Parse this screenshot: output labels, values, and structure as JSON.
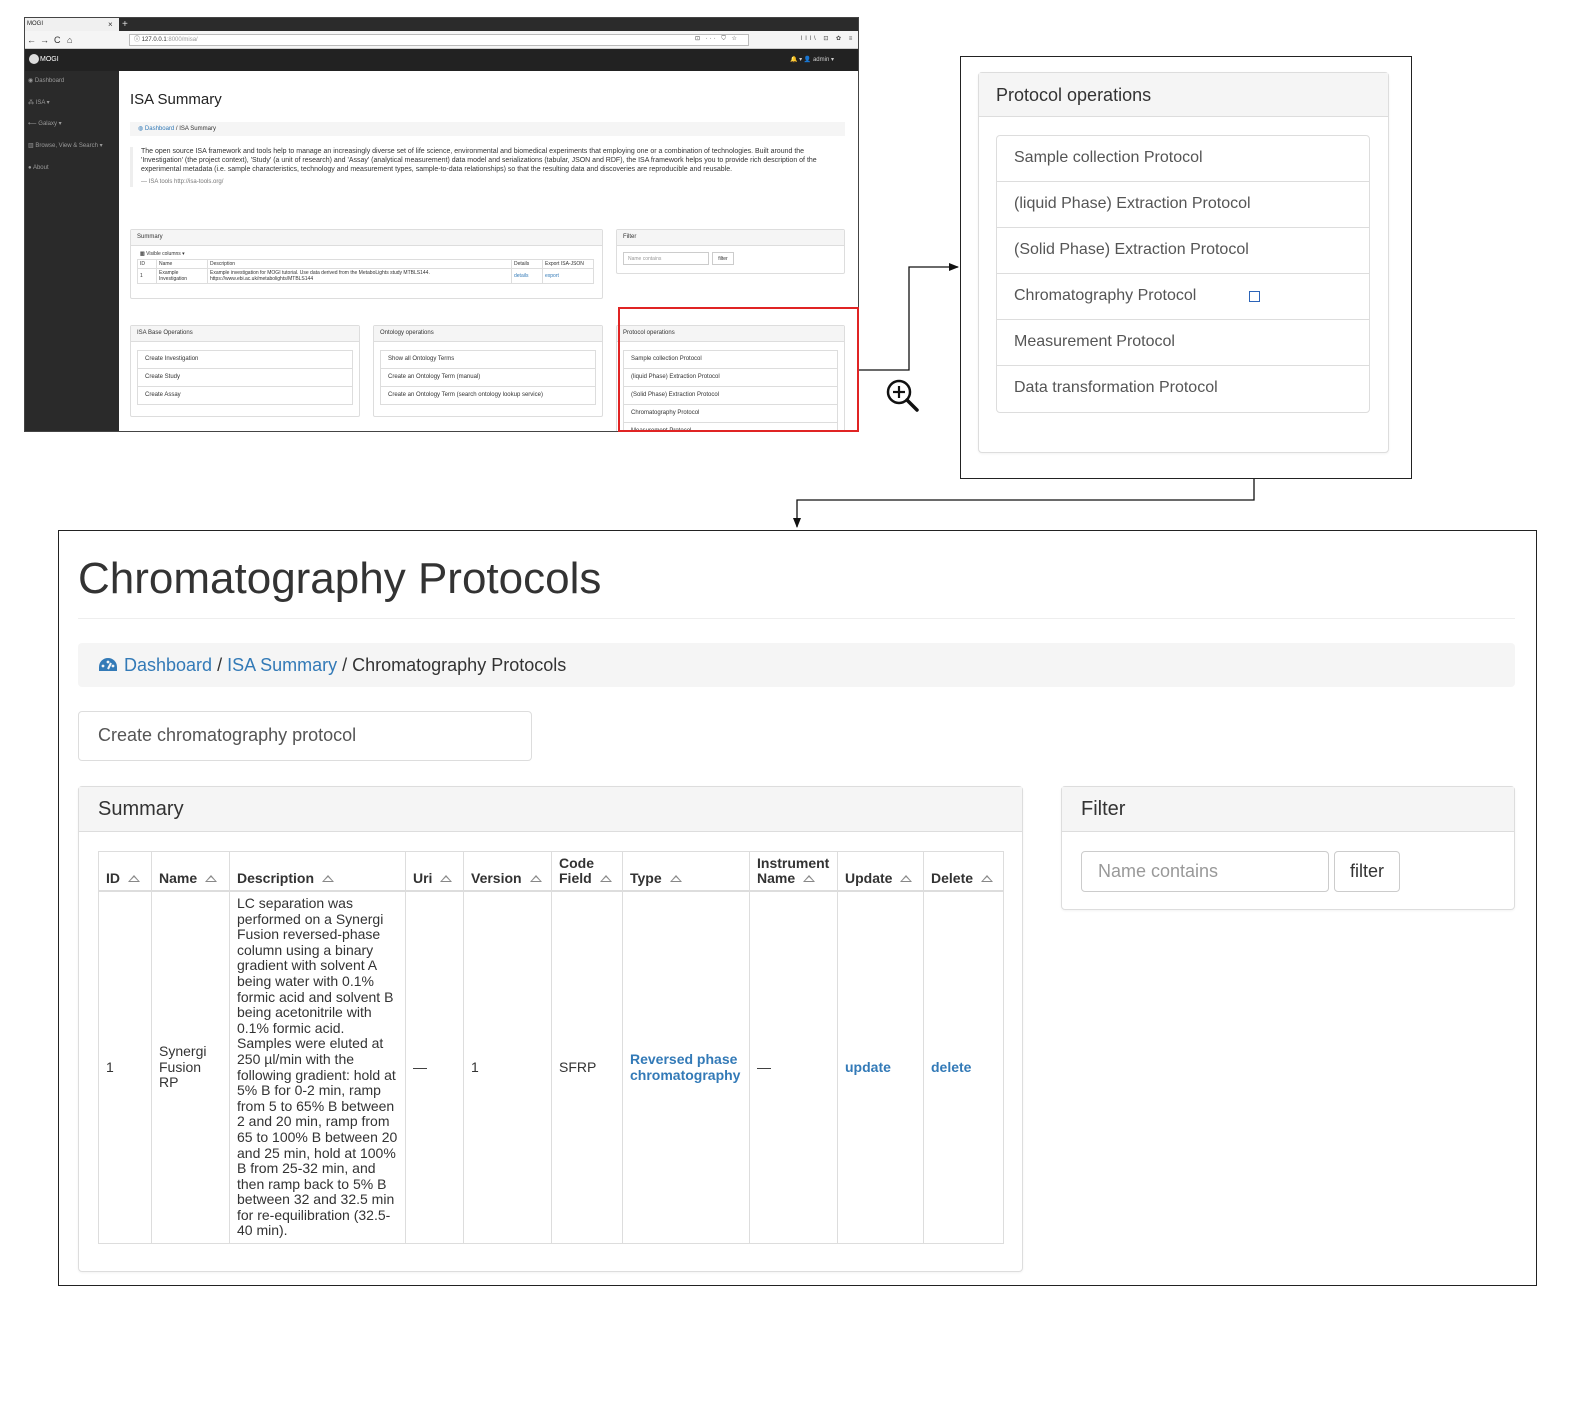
{
  "browser": {
    "tab_title": "MOGI",
    "tab_close": "×",
    "new_tab": "+",
    "nav_back": "←",
    "nav_forward": "→",
    "nav_reload": "C",
    "nav_home": "⌂",
    "url_host": "127.0.0.1",
    "url_path": ":8000/misa/",
    "url_tools": "⊡ ··· ⛉ ☆",
    "toolbar_icons": "lll\\ ⊡ ✿ ≡"
  },
  "app": {
    "logo_text": "MOGI",
    "topbar_right": "🔔 ▾   👤 admin ▾",
    "sidebar": [
      {
        "label": "Dashboard"
      },
      {
        "label": "ISA ▾"
      },
      {
        "label": "Galaxy ▾"
      },
      {
        "label": "Browse, View & Search ▾"
      },
      {
        "label": "About"
      }
    ],
    "isa_title": "ISA Summary",
    "breadcrumb_link": "Dashboard",
    "breadcrumb_rest": " / ISA Summary",
    "quote": "The open source ISA framework and tools help to manage an increasingly diverse set of life science, environmental and biomedical experiments that employing one or a combination of technologies. Built around the 'Investigation' (the project context), 'Study' (a unit of research) and 'Assay' (analytical measurement) data model and serializations (tabular, JSON and RDF), the ISA framework helps you to provide rich description of the experimental metadata (i.e. sample characteristics, technology and measurement types, sample-to-data relationships) so that the resulting data and discoveries are reproducible and reusable.",
    "quote_source": "— ISA tools http://isa-tools.org/",
    "summary_heading": "Summary",
    "visible_columns": "Visible columns ▾",
    "mini_headers": [
      "ID",
      "Name",
      "Description",
      "Details",
      "Export ISA-JSON"
    ],
    "mini_row": {
      "id": "1",
      "name": "Example Investigation",
      "description": "Example investigation for MOGI tutorial. Use data derived from the MetaboLights study MTBLS144. https://www.ebi.ac.uk/metabolights/MTBLS144",
      "details": "details",
      "export": "export"
    },
    "filter_heading": "Filter",
    "filter_placeholder": "Name contains",
    "filter_button": "filter",
    "base_ops_heading": "ISA Base Operations",
    "base_ops": [
      "Create Investigation",
      "Create Study",
      "Create Assay"
    ],
    "ontology_heading": "Ontology operations",
    "ontology_ops": [
      "Show all Ontology Terms",
      "Create an Ontology Term (manual)",
      "Create an Ontology Term (search ontology lookup service)"
    ],
    "protocol_heading": "Protocol operations",
    "protocol_ops_visible": [
      "Sample collection Protocol",
      "(liquid Phase) Extraction Protocol",
      "(Solid Phase) Extraction Protocol",
      "Chromatography Protocol",
      "Measurement Protocol"
    ]
  },
  "zoom_panel": {
    "heading": "Protocol operations",
    "items": [
      "Sample collection Protocol",
      "(liquid Phase) Extraction Protocol",
      "(Solid Phase) Extraction Protocol",
      "Chromatography Protocol",
      "Measurement Protocol",
      "Data transformation Protocol"
    ]
  },
  "chromatography_page": {
    "title": "Chromatography Protocols",
    "breadcrumb": {
      "dashboard": "Dashboard",
      "sep1": " / ",
      "isa_summary": "ISA Summary",
      "sep2": " / ",
      "current": "Chromatography Protocols"
    },
    "create_button": "Create chromatography protocol",
    "summary_heading": "Summary",
    "filter_heading": "Filter",
    "filter_placeholder": "Name contains",
    "filter_button": "filter",
    "table": {
      "headers": [
        "ID",
        "Name",
        "Description",
        "Uri",
        "Version",
        "Code Field",
        "Type",
        "Instrument Name",
        "Update",
        "Delete"
      ],
      "row": {
        "id": "1",
        "name": "Synergi Fusion RP",
        "description": "LC separation was performed on a Synergi Fusion reversed-phase column using a binary gradient with solvent A being water with 0.1% formic acid and solvent B being acetonitrile with 0.1% formic acid. Samples were eluted at 250 µl/min with the following gradient: hold at 5% B for 0-2 min, ramp from 5 to 65% B between 2 and 20 min, ramp from 65 to 100% B between 20 and 25 min, hold at 100% B from 25-32 min, and then ramp back to 5% B between 32 and 32.5 min for re-equilibration (32.5-40 min).",
        "uri": "—",
        "version": "1",
        "code_field": "SFRP",
        "type": "Reversed phase chromatography",
        "instrument_name": "—",
        "update": "update",
        "delete": "delete"
      }
    }
  },
  "colors": {
    "highlight_box": "#e02424",
    "link": "#337ab7",
    "sidebar": "#2a2a2a",
    "marker": "#2c64b8"
  },
  "icons": [
    "zoom-in-icon",
    "dashboard-icon",
    "arrow-right-icon",
    "arrow-down-icon"
  ]
}
